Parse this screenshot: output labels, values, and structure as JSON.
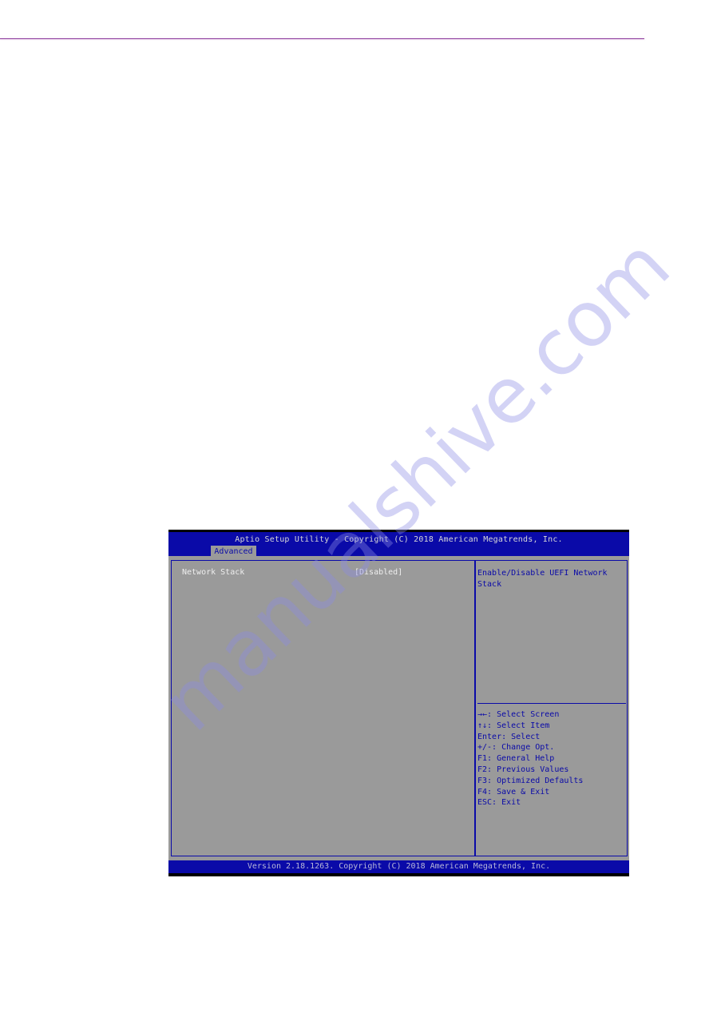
{
  "page": {
    "watermark": "manualshive.com",
    "colors": {
      "bios_blue": "#0a0aa8",
      "bios_gray": "#9a9a9a",
      "rule": "#8a3a9a"
    }
  },
  "bios": {
    "title": "Aptio Setup Utility - Copyright (C) 2018 American Megatrends, Inc.",
    "active_tab": "Advanced",
    "settings": [
      {
        "label": "Network Stack",
        "value": "[Disabled]"
      }
    ],
    "help": {
      "description": "Enable/Disable UEFI Network Stack"
    },
    "keys": [
      "→←: Select Screen",
      "↑↓: Select Item",
      "Enter: Select",
      "+/-: Change Opt.",
      "F1: General Help",
      "F2: Previous Values",
      "F3: Optimized Defaults",
      "F4: Save & Exit",
      "ESC: Exit"
    ],
    "footer": "Version 2.18.1263. Copyright (C) 2018 American Megatrends, Inc."
  }
}
